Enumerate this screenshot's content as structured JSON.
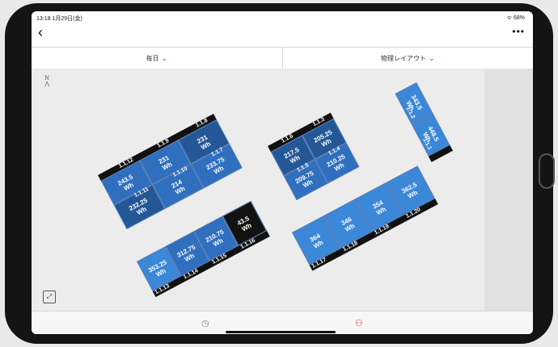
{
  "status": {
    "time": "13:18  1月29日(金)",
    "battery": "ᯤ 68%"
  },
  "nav": {
    "back": "‹",
    "more": "•••"
  },
  "tabs": [
    "毎日",
    "物理レイアウト"
  ],
  "compass": {
    "letter": "N"
  },
  "colors": {
    "accent": "#d32f2f",
    "panel_light": "#3b87d8",
    "panel_mid": "#2f6fbe",
    "panel_dark": "#245796",
    "panel_black": "#121212"
  },
  "arrays": [
    {
      "id": "A",
      "cells": [
        {
          "label": "1.1.8",
          "value": "231",
          "unit": "Wh"
        },
        {
          "label": "1.1.9",
          "value": "231",
          "unit": "Wh"
        },
        {
          "label": "1.1.12",
          "value": "243.5",
          "unit": "Wh"
        },
        {
          "label": "1.1.7",
          "value": "233.75",
          "unit": "Wh"
        },
        {
          "label": "1.1.10",
          "value": "214",
          "unit": "Wh"
        },
        {
          "label": "1.1.11",
          "value": "232.25",
          "unit": "Wh"
        }
      ]
    },
    {
      "id": "B",
      "cells": [
        {
          "label": "1.1.3",
          "value": "205.25",
          "unit": "Wh"
        },
        {
          "label": "1.1.6",
          "value": "217.5",
          "unit": "Wh"
        },
        {
          "label": "1.1.4",
          "value": "210.25",
          "unit": "Wh"
        },
        {
          "label": "1.1.5",
          "value": "209.75",
          "unit": "Wh"
        }
      ]
    },
    {
      "id": "C",
      "cells": [
        {
          "label": "1.1.2",
          "value": "343.5",
          "unit": "Wh"
        },
        {
          "label": "1.1.1",
          "value": "448.5",
          "unit": "Wh"
        }
      ]
    },
    {
      "id": "D",
      "cells": [
        {
          "label": "1.1.13",
          "value": "353.25",
          "unit": "Wh"
        },
        {
          "label": "1.1.14",
          "value": "312.75",
          "unit": "Wh"
        },
        {
          "label": "1.1.15",
          "value": "210.75",
          "unit": "Wh"
        },
        {
          "label": "1.1.16",
          "value": "43.5",
          "unit": "Wh"
        }
      ]
    },
    {
      "id": "E",
      "cells": [
        {
          "label": "1.1.17",
          "value": "364",
          "unit": "Wh"
        },
        {
          "label": "1.1.18",
          "value": "346",
          "unit": "Wh"
        },
        {
          "label": "1.1.19",
          "value": "354",
          "unit": "Wh"
        },
        {
          "label": "1.1.20",
          "value": "362.5",
          "unit": "Wh"
        }
      ]
    }
  ],
  "bottom": {
    "left_icon": "clock-icon",
    "right_icon": "network-icon"
  }
}
